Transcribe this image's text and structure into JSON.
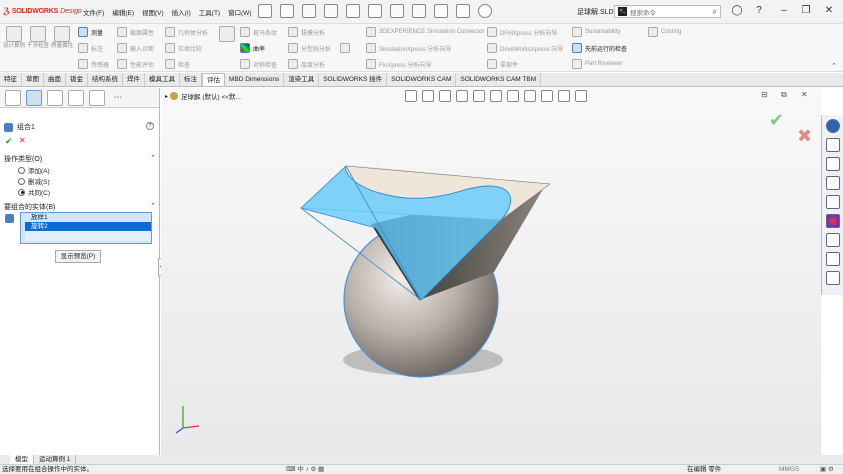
{
  "titlebar": {
    "brand": "SOLIDWORKS",
    "brand_suffix": "Design",
    "menus": [
      "文件(F)",
      "编辑(E)",
      "视图(V)",
      "插入(I)",
      "工具(T)",
      "窗口(W)"
    ],
    "filename": "足球解.SLDPRT *",
    "search_placeholder": "搜索命令"
  },
  "cmdmgr": {
    "big": [
      "设计算例",
      "干涉检查",
      "质量属性"
    ],
    "small": [
      {
        "label": "测量",
        "active": true
      },
      {
        "label": "标注",
        "active": false
      },
      {
        "label": "传感器",
        "active": false
      },
      {
        "label": "截面属性",
        "active": false
      },
      {
        "label": "输入诊断",
        "active": false
      },
      {
        "label": "性能评估",
        "active": false
      },
      {
        "label": "几何体分析",
        "active": false
      },
      {
        "label": "实体比较",
        "active": false
      },
      {
        "label": "检查",
        "active": false
      },
      {
        "label": "曲率",
        "active": true
      },
      {
        "label": "斑马条纹",
        "active": false
      },
      {
        "label": "对称检查",
        "active": false
      },
      {
        "label": "拔模分析",
        "active": false
      },
      {
        "label": "分型线分析",
        "active": false
      },
      {
        "label": "厚度分析",
        "active": false
      },
      {
        "label": "3DEXPERIENCE Simulation Connector",
        "active": false
      },
      {
        "label": "SimulationXpress 分析向导",
        "active": false
      },
      {
        "label": "FloXpress 分析向导",
        "active": false
      },
      {
        "label": "DFMXpress 分析向导",
        "active": false
      },
      {
        "label": "DriveWorksXpress 向导",
        "active": false
      },
      {
        "label": "零部件",
        "active": false
      },
      {
        "label": "Sustainability",
        "active": false
      },
      {
        "label": "Costing",
        "active": false
      },
      {
        "label": "先前运行的检查",
        "active": true
      },
      {
        "label": "Part Reviewer",
        "active": false
      }
    ]
  },
  "tabs": [
    "特征",
    "草图",
    "曲面",
    "钣金",
    "结构系统",
    "焊件",
    "模具工具",
    "标注",
    "评估",
    "MBD Dimensions",
    "渲染工具",
    "SOLIDWORKS 插件",
    "SOLIDWORKS CAM",
    "SOLIDWORKS CAM TBM"
  ],
  "active_tab": "评估",
  "panel": {
    "title": "组合1",
    "op_section": "操作类型(O)",
    "ops": [
      {
        "label": "添加(A)",
        "checked": false
      },
      {
        "label": "删减(S)",
        "checked": false
      },
      {
        "label": "共同(C)",
        "checked": true
      }
    ],
    "bodies_section": "要组合的实体(B)",
    "bodies": [
      {
        "label": "放样1",
        "selected": false
      },
      {
        "label": "旋转2",
        "selected": true
      }
    ],
    "preview_button": "显示预览(P)"
  },
  "viewport": {
    "breadcrumb": "足球解 (默认) <<默..."
  },
  "bottom_tabs": [
    "模型",
    "运动算例 1"
  ],
  "status": {
    "left": "选择要用在组合操作中的实体。",
    "right_state": "在编辑 零件",
    "units": "MMGS"
  },
  "colors": {
    "accent_blue": "#0a6bd6",
    "brand_red": "#d52b1e",
    "surface_cyan": "#4fc3ff",
    "sphere_gray": "#8f8a85"
  }
}
